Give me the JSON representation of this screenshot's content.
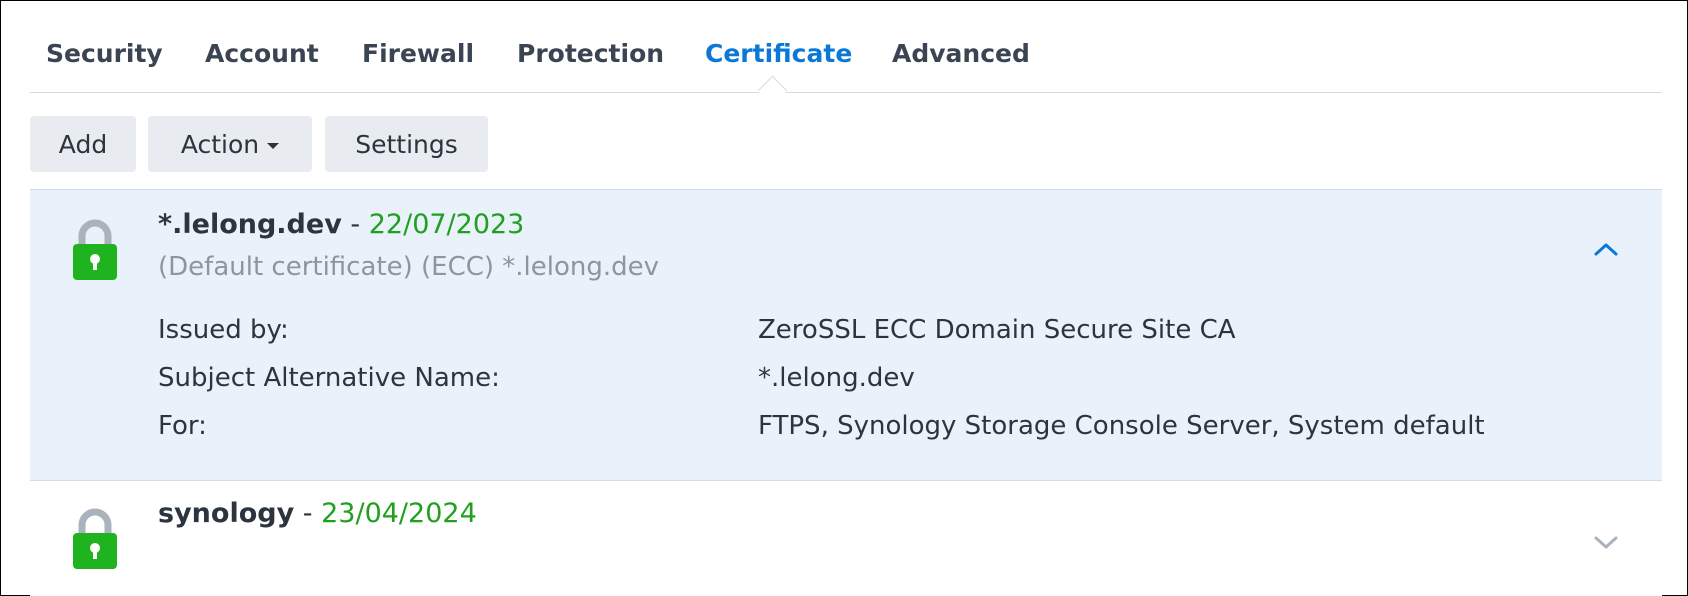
{
  "tabs": [
    {
      "label": "Security"
    },
    {
      "label": "Account"
    },
    {
      "label": "Firewall"
    },
    {
      "label": "Protection"
    },
    {
      "label": "Certificate",
      "active": true
    },
    {
      "label": "Advanced"
    }
  ],
  "toolbar": {
    "add_label": "Add",
    "action_label": "Action",
    "settings_label": "Settings"
  },
  "certificates": [
    {
      "name": "*.lelong.dev",
      "separator": "-",
      "date": "22/07/2023",
      "subtitle": "(Default certificate) (ECC) *.lelong.dev",
      "expanded": true,
      "details": [
        {
          "label": "Issued by:",
          "value": "ZeroSSL ECC Domain Secure Site CA"
        },
        {
          "label": "Subject Alternative Name:",
          "value": "*.lelong.dev"
        },
        {
          "label": "For:",
          "value": "FTPS, Synology Storage Console Server, System default"
        }
      ],
      "icon": "lock-icon"
    },
    {
      "name": "synology",
      "separator": "-",
      "date": "23/04/2024",
      "expanded": false,
      "icon": "lock-icon"
    }
  ],
  "colors": {
    "accent": "#0b78d8",
    "valid_date": "#1fa01f",
    "lock_body": "#1fb31f",
    "lock_shackle": "#a9b2bd",
    "expanded_bg": "#e9f1fb"
  }
}
